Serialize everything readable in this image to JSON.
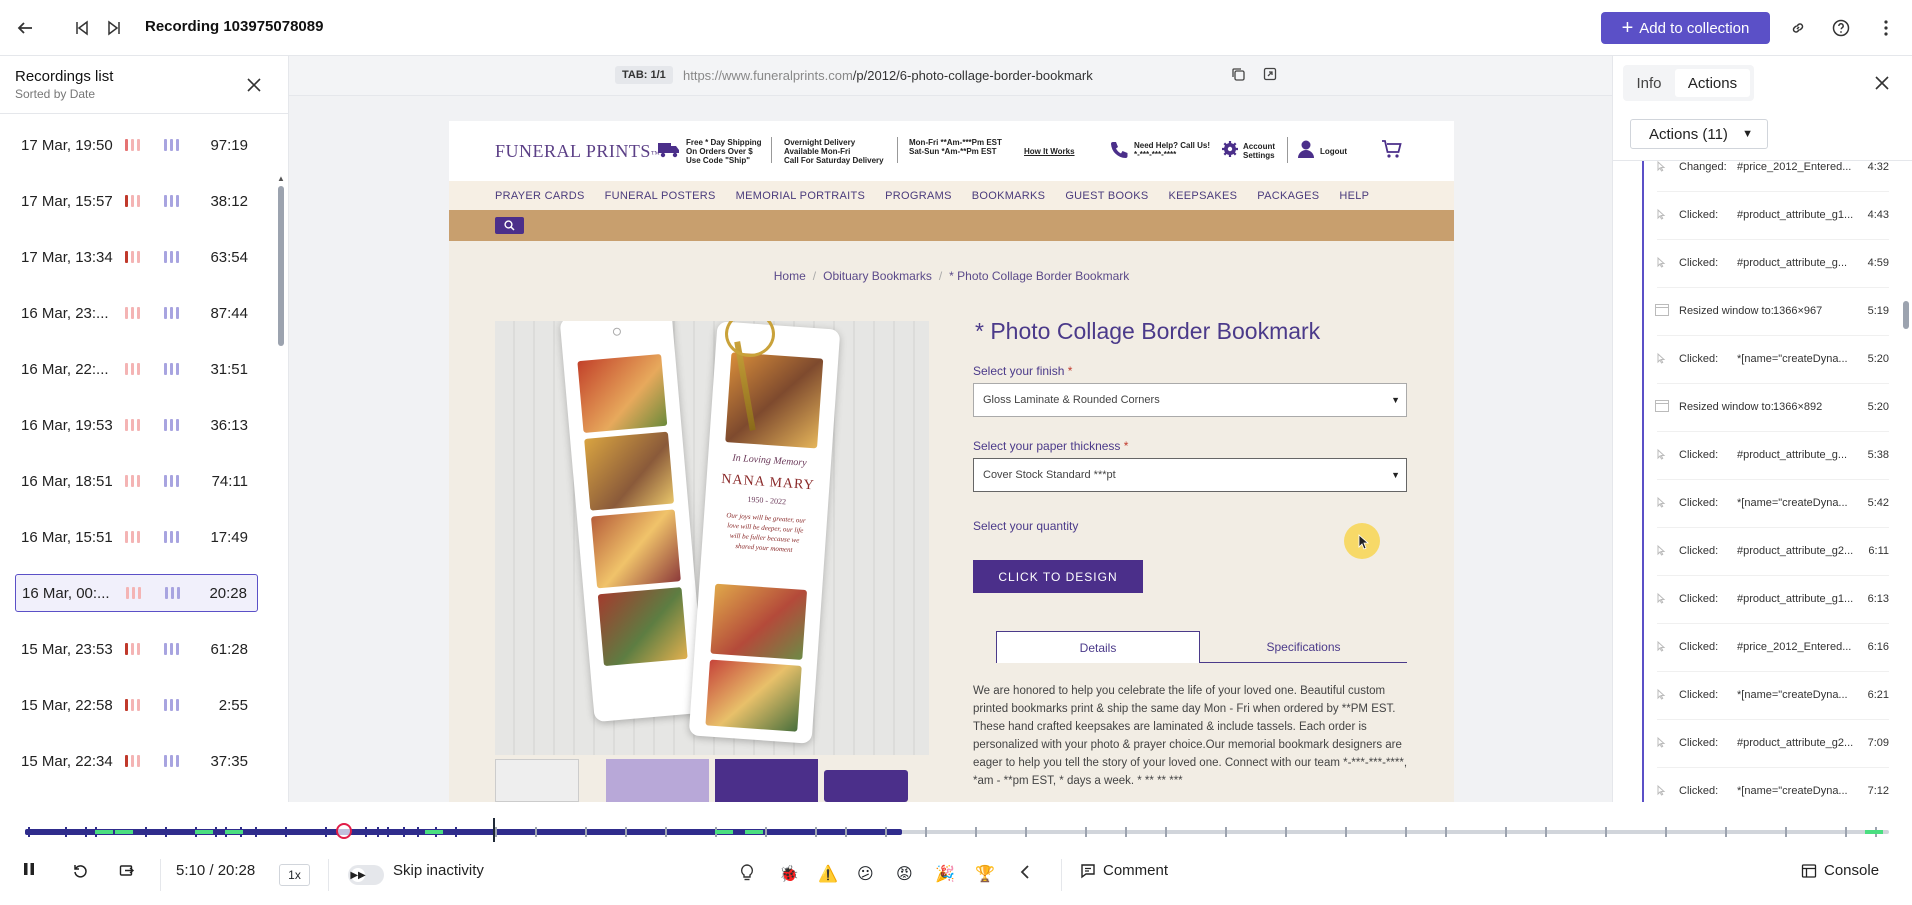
{
  "topbar": {
    "title": "Recording 103975078089",
    "add_label": "Add to collection"
  },
  "recordings": {
    "title": "Recordings list",
    "subtitle": "Sorted by Date",
    "items": [
      {
        "date": "17 Mar, 19:50",
        "duration": "97:19"
      },
      {
        "date": "17 Mar, 15:57",
        "duration": "38:12"
      },
      {
        "date": "17 Mar, 13:34",
        "duration": "63:54"
      },
      {
        "date": "16 Mar, 23:...",
        "duration": "87:44"
      },
      {
        "date": "16 Mar, 22:...",
        "duration": "31:51"
      },
      {
        "date": "16 Mar, 19:53",
        "duration": "36:13"
      },
      {
        "date": "16 Mar, 18:51",
        "duration": "74:11"
      },
      {
        "date": "16 Mar, 15:51",
        "duration": "17:49"
      },
      {
        "date": "16 Mar, 00:...",
        "duration": "20:28"
      },
      {
        "date": "15 Mar, 23:53",
        "duration": "61:28"
      },
      {
        "date": "15 Mar, 22:58",
        "duration": "2:55"
      },
      {
        "date": "15 Mar, 22:34",
        "duration": "37:35"
      }
    ]
  },
  "browser": {
    "tab_badge": "TAB: 1/1",
    "url_prefix": "https://www.funeralprints.com",
    "url_path": "/p/2012/6-photo-collage-border-bookmark"
  },
  "site": {
    "logo": "FUNERAL PRINTS",
    "logo_tm": "™",
    "shipping_text": "Free * Day Shipping\nOn Orders Over $\nUse Code \"Ship\"",
    "delivery_text": "Overnight Delivery\nAvailable Mon-Fri\nCall For Saturday Delivery",
    "hours_text": "Mon-Fri **Am-***Pm EST\nSat-Sun *Am-**Pm EST",
    "how_it_works": "How It Works",
    "help_text": "Need Help? Call Us!\n*-***-***-****",
    "account_text": "Account\nSettings",
    "logout": "Logout",
    "nav": [
      "PRAYER CARDS",
      "FUNERAL POSTERS",
      "MEMORIAL PORTRAITS",
      "PROGRAMS",
      "BOOKMARKS",
      "GUEST BOOKS",
      "KEEPSAKES",
      "PACKAGES",
      "HELP"
    ],
    "breadcrumb": [
      "Home",
      "Obituary Bookmarks",
      "* Photo Collage Border Bookmark"
    ],
    "product_title": "* Photo Collage Border Bookmark",
    "finish_label": "Select your finish",
    "finish_value": "Gloss Laminate & Rounded Corners",
    "thickness_label": "Select your paper thickness",
    "thickness_value": "Cover Stock Standard ***pt",
    "quantity_label": "Select your quantity",
    "design_button": "CLICK TO DESIGN",
    "tab_details": "Details",
    "tab_specs": "Specifications",
    "description": "We are honored to help you celebrate the life of your loved one. Beautiful custom printed bookmarks print & ship the same day Mon - Fri when ordered by **PM EST. These hand crafted keepsakes are laminated & include tassels. Each order is personalized with your photo & prayer choice.Our memorial bookmark designers are eager to help you tell the story of your loved one. Connect with our team *-***-***-****, *am - **pm EST, * days a week. * ** ** ***",
    "bookmark_text": {
      "line1": "In Loving Memory",
      "name": "NANA MARY",
      "years": "1950 - 2022",
      "verse": "Our joys will be greater, our love will be deeper, our life will be fuller because we shared your moment"
    }
  },
  "panel": {
    "tab_info": "Info",
    "tab_actions": "Actions",
    "actions_dropdown": "Actions (11)",
    "actions": [
      {
        "type": "Changed:",
        "target": "#price_2012_Entered...",
        "time": "4:32",
        "icon": "click"
      },
      {
        "type": "Clicked:",
        "target": "#product_attribute_g1...",
        "time": "4:43",
        "icon": "click"
      },
      {
        "type": "Clicked:",
        "target": "#product_attribute_g...",
        "time": "4:59",
        "icon": "click"
      },
      {
        "type": "Resized window to:",
        "target": "1366×967",
        "time": "5:19",
        "icon": "resize"
      },
      {
        "type": "Clicked:",
        "target": "*[name=\"createDyna...",
        "time": "5:20",
        "icon": "click"
      },
      {
        "type": "Resized window to:",
        "target": "1366×892",
        "time": "5:20",
        "icon": "resize"
      },
      {
        "type": "Clicked:",
        "target": "#product_attribute_g...",
        "time": "5:38",
        "icon": "click"
      },
      {
        "type": "Clicked:",
        "target": "*[name=\"createDyna...",
        "time": "5:42",
        "icon": "click"
      },
      {
        "type": "Clicked:",
        "target": "#product_attribute_g2...",
        "time": "6:11",
        "icon": "click"
      },
      {
        "type": "Clicked:",
        "target": "#product_attribute_g1...",
        "time": "6:13",
        "icon": "click"
      },
      {
        "type": "Clicked:",
        "target": "#price_2012_Entered...",
        "time": "6:16",
        "icon": "click"
      },
      {
        "type": "Clicked:",
        "target": "*[name=\"createDyna...",
        "time": "6:21",
        "icon": "click"
      },
      {
        "type": "Clicked:",
        "target": "#product_attribute_g2...",
        "time": "7:09",
        "icon": "click"
      },
      {
        "type": "Clicked:",
        "target": "*[name=\"createDyna...",
        "time": "7:12",
        "icon": "click"
      }
    ]
  },
  "player": {
    "time": "5:10 / 20:28",
    "speed": "1x",
    "skip_label": "Skip inactivity",
    "comment_label": "Comment",
    "console_label": "Console",
    "progress": 0.253,
    "colors": {
      "accent": "#5b50c7",
      "played": "#2f2c8c",
      "event": "#4ade80",
      "error": "#e11d48"
    }
  }
}
